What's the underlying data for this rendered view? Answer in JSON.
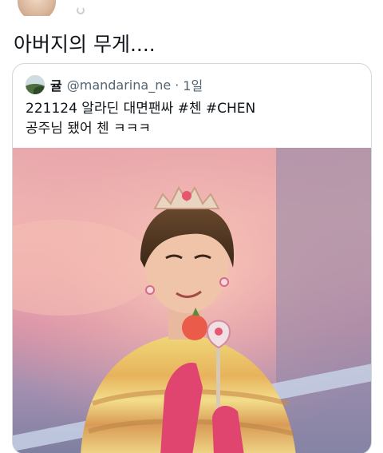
{
  "tweet": {
    "text": "아버지의 무게...."
  },
  "quote": {
    "display_name": "귤",
    "handle": "@mandarina_ne",
    "separator": "·",
    "time": "1일",
    "lines": [
      "221124 알라딘 대면팬싸 #첸 #CHEN",
      "공주님 됐어 첸 ㅋㅋㅋ"
    ]
  },
  "icons": {
    "author_avatar": "avatar",
    "quote_avatar": "landscape-avatar"
  }
}
